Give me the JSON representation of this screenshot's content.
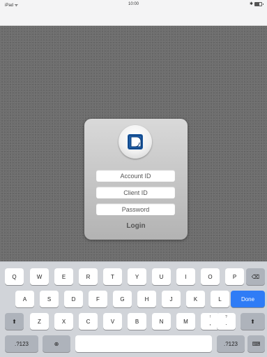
{
  "status_bar": {
    "left": "iPad ᯤ",
    "time": "10:00",
    "right": "✱"
  },
  "login": {
    "account_placeholder": "Account ID",
    "client_placeholder": "Client ID",
    "password_placeholder": "Password",
    "login_label": "Login"
  },
  "keyboard": {
    "row1": [
      "Q",
      "W",
      "E",
      "R",
      "T",
      "Y",
      "U",
      "I",
      "O",
      "P"
    ],
    "row2": [
      "A",
      "S",
      "D",
      "F",
      "G",
      "H",
      "J",
      "K",
      "L"
    ],
    "row3": [
      "Z",
      "X",
      "C",
      "V",
      "B",
      "N",
      "M"
    ],
    "row3_punct": [
      {
        "top": "!",
        "main": ","
      },
      {
        "top": "?",
        "main": "."
      }
    ],
    "done_label": "Done",
    "numbers_label": ".?123",
    "backspace_icon": "⌫",
    "shift_icon": "⬆",
    "globe_icon": "⊕",
    "hide_keyboard_icon": "⌨"
  },
  "colors": {
    "done_blue": "#2f7cf6",
    "background_gray": "#6c6c6c"
  }
}
